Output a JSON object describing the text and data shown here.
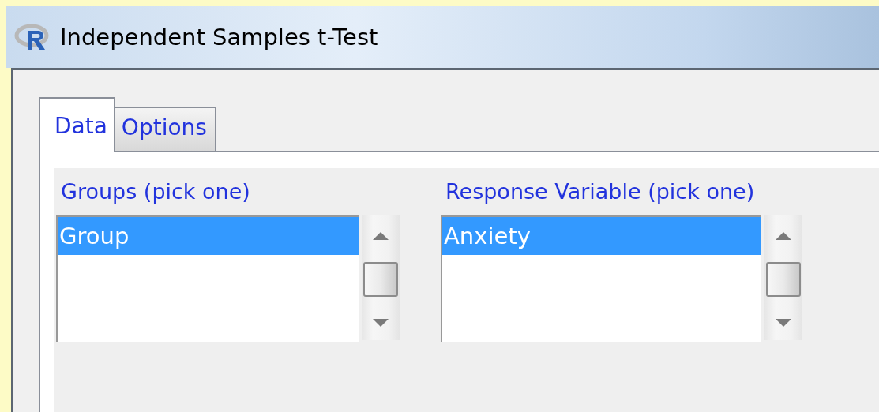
{
  "window": {
    "title": "Independent Samples t-Test"
  },
  "tabs": [
    {
      "label": "Data",
      "selected": true
    },
    {
      "label": "Options",
      "selected": false
    }
  ],
  "lists": [
    {
      "label": "Groups (pick one)",
      "items": [
        {
          "text": "Group",
          "selected": true
        }
      ]
    },
    {
      "label": "Response Variable (pick one)",
      "items": [
        {
          "text": "Anxiety",
          "selected": true
        }
      ]
    }
  ]
}
